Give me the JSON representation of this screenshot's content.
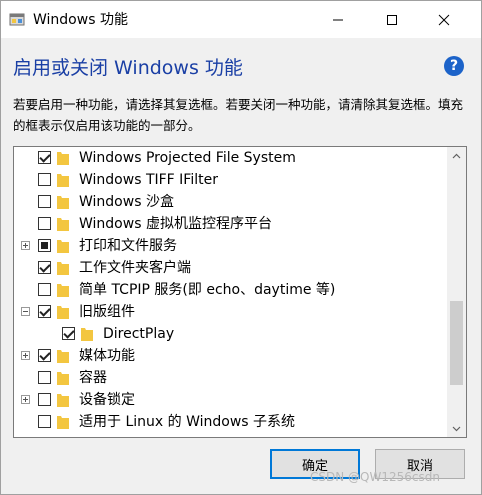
{
  "window": {
    "title": "Windows 功能"
  },
  "header": {
    "heading": "启用或关闭 Windows 功能",
    "description": "若要启用一种功能，请选择其复选框。若要关闭一种功能，请清除其复选框。填充的框表示仅启用该功能的一部分。"
  },
  "features": [
    {
      "label": "Windows Projected File System",
      "state": "checked",
      "expander": "none",
      "indent": 0
    },
    {
      "label": "Windows TIFF IFilter",
      "state": "unchecked",
      "expander": "none",
      "indent": 0
    },
    {
      "label": "Windows 沙盒",
      "state": "unchecked",
      "expander": "none",
      "indent": 0
    },
    {
      "label": "Windows 虚拟机监控程序平台",
      "state": "unchecked",
      "expander": "none",
      "indent": 0
    },
    {
      "label": "打印和文件服务",
      "state": "partial",
      "expander": "plus",
      "indent": 0
    },
    {
      "label": "工作文件夹客户端",
      "state": "checked",
      "expander": "none",
      "indent": 0
    },
    {
      "label": "简单 TCPIP 服务(即 echo、daytime 等)",
      "state": "unchecked",
      "expander": "none",
      "indent": 0
    },
    {
      "label": "旧版组件",
      "state": "checked",
      "expander": "minus",
      "indent": 0
    },
    {
      "label": "DirectPlay",
      "state": "checked",
      "expander": "none",
      "indent": 1
    },
    {
      "label": "媒体功能",
      "state": "checked",
      "expander": "plus",
      "indent": 0
    },
    {
      "label": "容器",
      "state": "unchecked",
      "expander": "none",
      "indent": 0
    },
    {
      "label": "设备锁定",
      "state": "unchecked",
      "expander": "plus",
      "indent": 0
    },
    {
      "label": "适用于 Linux 的 Windows 子系统",
      "state": "unchecked",
      "expander": "none",
      "indent": 0
    }
  ],
  "buttons": {
    "ok": "确定",
    "cancel": "取消"
  },
  "watermark": "CSDN @QW1256csdn",
  "colors": {
    "heading": "#1a3fa5",
    "help": "#1c63c9",
    "folder": "#f3c640",
    "accent": "#0078d7"
  }
}
